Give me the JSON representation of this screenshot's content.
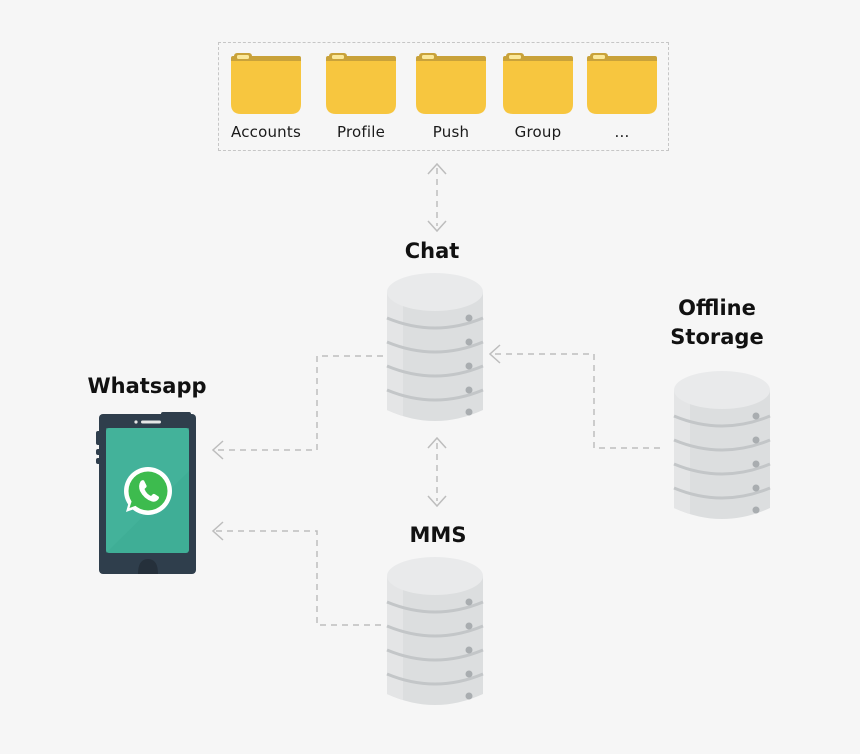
{
  "folders": [
    {
      "label": "Accounts",
      "icon": "folder-icon"
    },
    {
      "label": "Profile",
      "icon": "folder-icon"
    },
    {
      "label": "Push",
      "icon": "folder-icon"
    },
    {
      "label": "Group",
      "icon": "folder-icon"
    },
    {
      "label": "...",
      "icon": "folder-icon"
    }
  ],
  "nodes": {
    "chat": {
      "label": "Chat",
      "icon": "database-icon"
    },
    "mms": {
      "label": "MMS",
      "icon": "database-icon"
    },
    "offline": {
      "label_line1": "Offline",
      "label_line2": "Storage",
      "icon": "database-icon"
    },
    "whatsapp": {
      "label": "Whatsapp",
      "icon": "smartphone-icon",
      "app_icon": "whatsapp-logo-icon"
    }
  },
  "connections": [
    {
      "from": "folders",
      "to": "Chat",
      "style": "dashed",
      "direction": "bidirectional"
    },
    {
      "from": "Chat",
      "to": "MMS",
      "style": "dashed",
      "direction": "bidirectional"
    },
    {
      "from": "Offline Storage",
      "to": "Chat",
      "style": "dashed",
      "direction": "one-way"
    },
    {
      "from": "Chat",
      "to": "Whatsapp",
      "style": "dashed",
      "direction": "one-way"
    },
    {
      "from": "MMS",
      "to": "Whatsapp",
      "style": "dashed",
      "direction": "one-way"
    }
  ],
  "colors": {
    "background": "#f6f6f6",
    "folder": "#f7c63f",
    "folder_tab": "#c9a23a",
    "folder_tag": "#fbe89a",
    "database_body": "#dcdedf",
    "database_top": "#e9eaeb",
    "database_ring": "#c3c6c8",
    "database_dot": "#a9adb0",
    "phone_body": "#2f3e4c",
    "phone_screen": "#3fae96",
    "whatsapp_green": "#3dbb4e",
    "connector": "#bdbdbd"
  }
}
